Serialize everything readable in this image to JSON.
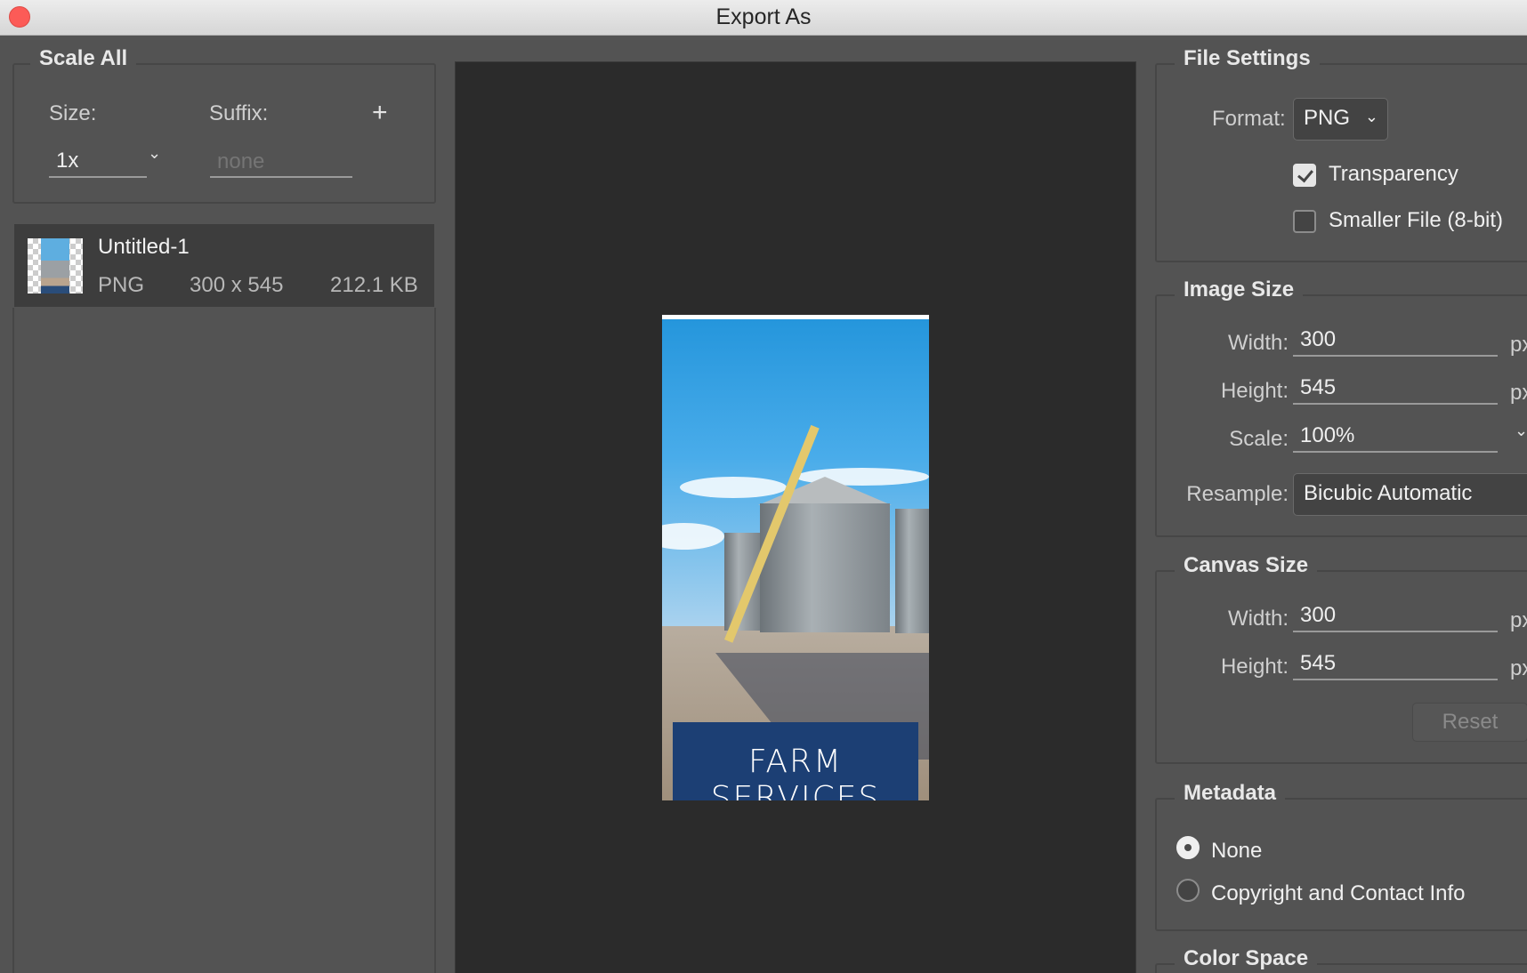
{
  "window": {
    "title": "Export As"
  },
  "scale_all": {
    "title": "Scale All",
    "size_label": "Size:",
    "suffix_label": "Suffix:",
    "size_value": "1x",
    "suffix_placeholder": "none",
    "add_icon": "plus-icon"
  },
  "asset": {
    "name": "Untitled-1",
    "format": "PNG",
    "dimensions": "300 x 545",
    "file_size": "212.1 KB"
  },
  "preview": {
    "banner_text": "FARM SERVICES"
  },
  "file_settings": {
    "title": "File Settings",
    "format_label": "Format:",
    "format_value": "PNG",
    "transparency_label": "Transparency",
    "transparency_checked": true,
    "smaller_file_label": "Smaller File (8-bit)",
    "smaller_file_checked": false
  },
  "image_size": {
    "title": "Image Size",
    "width_label": "Width:",
    "width_value": "300",
    "height_label": "Height:",
    "height_value": "545",
    "scale_label": "Scale:",
    "scale_value": "100%",
    "resample_label": "Resample:",
    "resample_value": "Bicubic Automatic",
    "unit": "px"
  },
  "canvas_size": {
    "title": "Canvas Size",
    "width_label": "Width:",
    "width_value": "300",
    "height_label": "Height:",
    "height_value": "545",
    "unit": "px",
    "reset_label": "Reset"
  },
  "metadata": {
    "title": "Metadata",
    "options": [
      "None",
      "Copyright and Contact Info"
    ],
    "selected": "None"
  },
  "color_space": {
    "title": "Color Space"
  },
  "colors": {
    "close": "#fc5b57",
    "panel": "#535353",
    "preview_bg": "#2b2b2b",
    "banner": "#1c3f74"
  }
}
